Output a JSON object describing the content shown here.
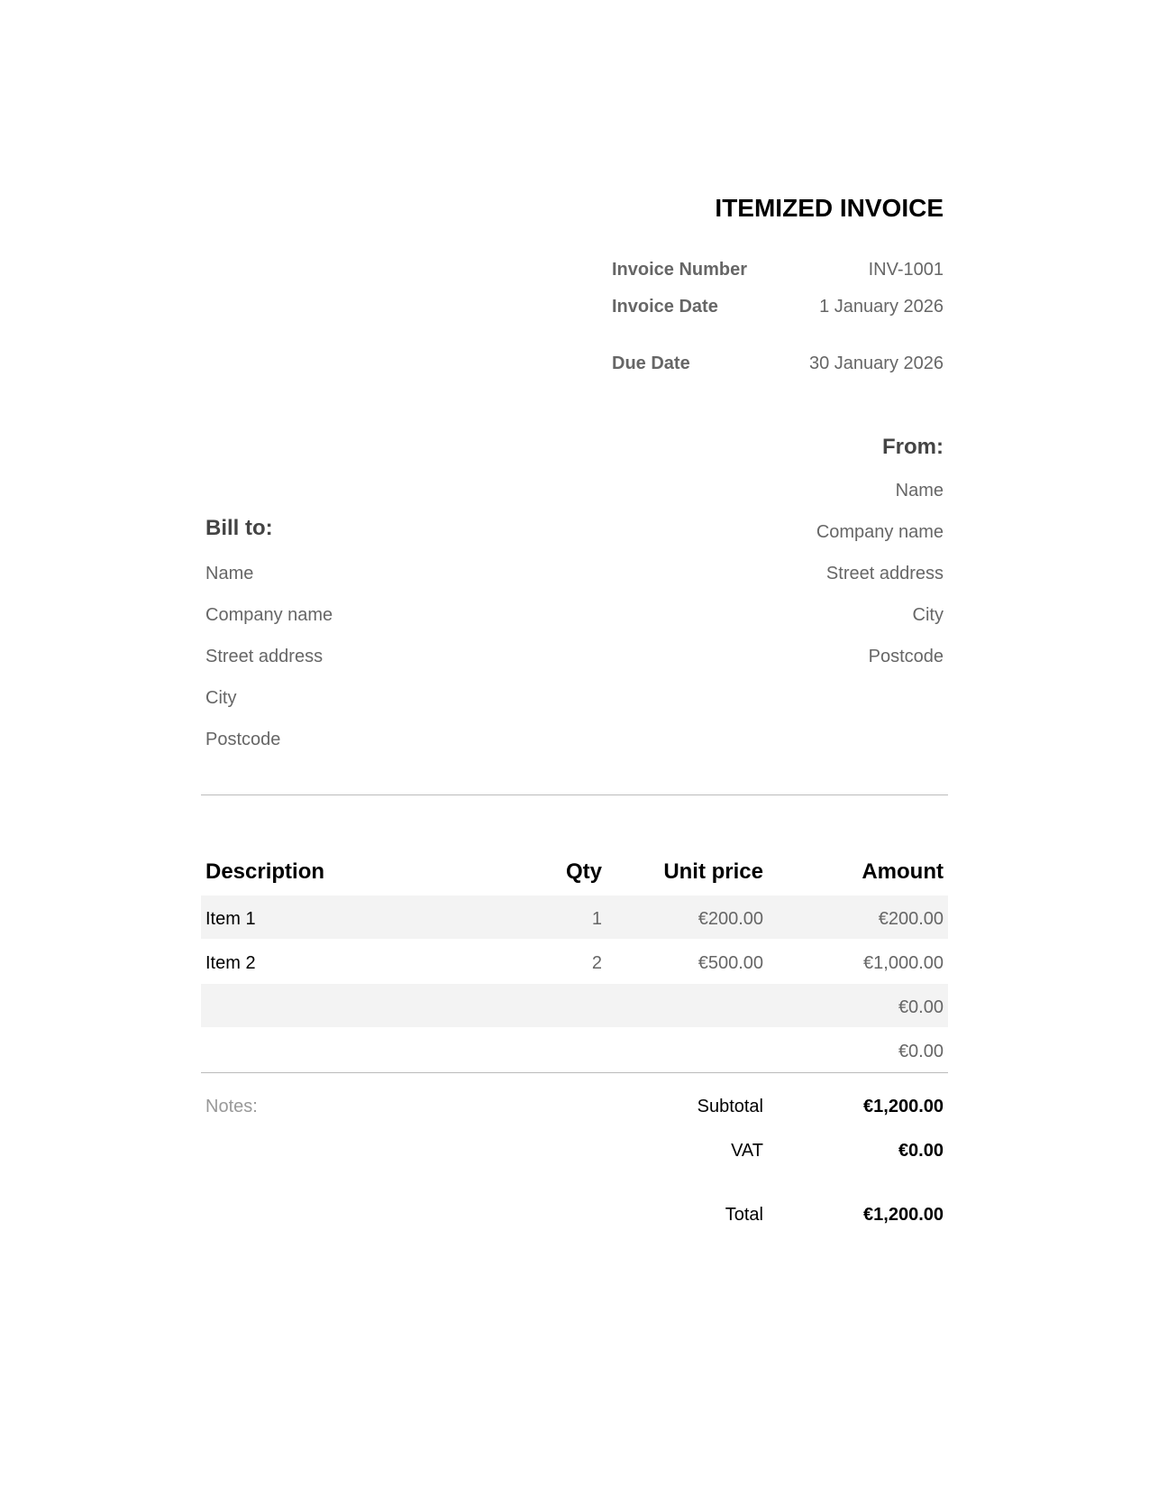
{
  "header": {
    "title": "ITEMIZED INVOICE",
    "meta": [
      {
        "label": "Invoice Number",
        "value": "INV-1001"
      },
      {
        "label": "Invoice Date",
        "value": "1 January 2026"
      },
      {
        "label": "Due Date",
        "value": "30 January 2026"
      }
    ]
  },
  "from": {
    "heading": "From:",
    "lines": [
      "Name",
      "Company name",
      "Street address",
      "City",
      "Postcode"
    ]
  },
  "bill_to": {
    "heading": "Bill to:",
    "lines": [
      "Name",
      "Company name",
      "Street address",
      "City",
      "Postcode"
    ]
  },
  "table": {
    "headers": {
      "description": "Description",
      "qty": "Qty",
      "unit_price": "Unit price",
      "amount": "Amount"
    },
    "rows": [
      {
        "description": "Item 1",
        "qty": "1",
        "unit_price": "€200.00",
        "amount": "€200.00"
      },
      {
        "description": "Item 2",
        "qty": "2",
        "unit_price": "€500.00",
        "amount": "€1,000.00"
      },
      {
        "description": "",
        "qty": "",
        "unit_price": "",
        "amount": "€0.00"
      },
      {
        "description": "",
        "qty": "",
        "unit_price": "",
        "amount": "€0.00"
      }
    ]
  },
  "notes": {
    "label": "Notes:"
  },
  "totals": {
    "subtotal_label": "Subtotal",
    "subtotal_value": "€1,200.00",
    "vat_label": "VAT",
    "vat_value": "€0.00",
    "total_label": "Total",
    "total_value": "€1,200.00"
  }
}
